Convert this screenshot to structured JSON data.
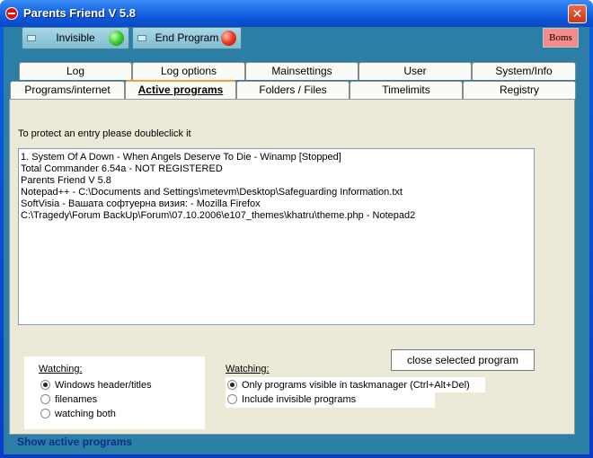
{
  "window": {
    "title": "Parents Friend V 5.8",
    "close_glyph": "✕"
  },
  "toolbar": {
    "invisible_label": "Invisible",
    "end_program_label": "End Program",
    "boms_label": "Boms"
  },
  "tabs": {
    "row1": [
      "Log",
      "Log options",
      "Mainsettings",
      "User",
      "System/Info"
    ],
    "row2": [
      "Programs/internet",
      "Active programs",
      "Folders / Files",
      "Timelimits",
      "Registry"
    ]
  },
  "active_programs": {
    "hint": "To protect an entry please doubleclick it",
    "entries": [
      "1. System Of A Down - When Angels Deserve To Die - Winamp [Stopped]",
      "Total Commander 6.54a - NOT REGISTERED",
      "Parents Friend V 5.8",
      "Notepad++ - C:\\Documents and Settings\\metevm\\Desktop\\Safeguarding Information.txt",
      "SoftVisia - Вашата софтуерна визия: - Mozilla Firefox",
      "C:\\Tragedy\\Forum BackUp\\Forum\\07.10.2006\\e107_themes\\khatru\\theme.php - Notepad2"
    ],
    "watching_left": {
      "label": "Watching:",
      "options": [
        "Windows header/titles",
        "filenames",
        "watching both"
      ],
      "selected": 0
    },
    "watching_right": {
      "label": "Watching:",
      "options": [
        "Only programs visible in taskmanager (Ctrl+Alt+Del)",
        "Include invisible programs"
      ],
      "selected": 0
    },
    "close_button_label": "close selected program"
  },
  "status": {
    "text": "Show active programs"
  }
}
